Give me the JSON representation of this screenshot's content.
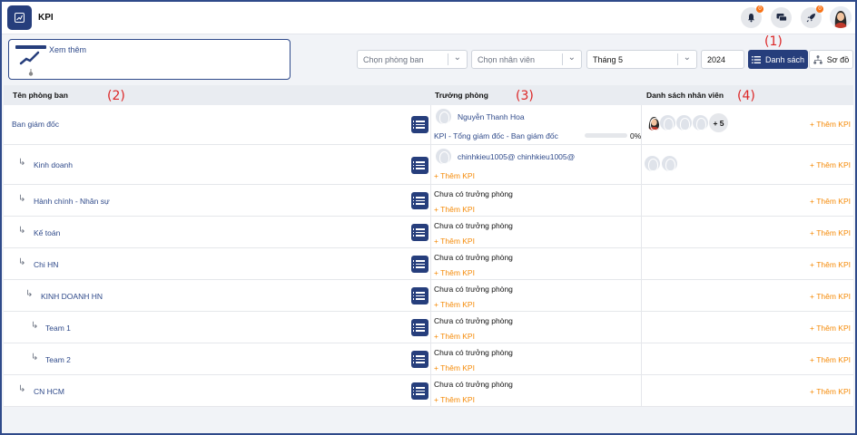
{
  "app": {
    "title": "KPI"
  },
  "header": {
    "notification_badge": "0",
    "rocket_badge": "0"
  },
  "toolbar": {
    "see_more_label": "Xem thêm",
    "department_select": {
      "placeholder": "Chọn phòng ban"
    },
    "employee_select": {
      "placeholder": "Chọn nhân viên"
    },
    "month_select": {
      "value": "Tháng 5"
    },
    "year_field": {
      "value": "2024"
    },
    "list_view_label": "Danh sách",
    "tree_view_label": "Sơ đồ"
  },
  "markers": {
    "m1": "(1)",
    "m2": "(2)",
    "m3": "(3)",
    "m4": "(4)"
  },
  "table": {
    "columns": {
      "department": "Tên phòng ban",
      "head": "Trưởng phòng",
      "staff": "Danh sách nhân viên"
    },
    "no_head_text": "Chưa có trưởng phòng",
    "add_kpi_text": "+ Thêm KPI",
    "rows": [
      {
        "name": "Ban giám đốc",
        "level": 0,
        "head_name": "Nguyễn Thanh Hoa",
        "kpi_title": "KPI - Tổng giám đốc - Ban giám đốc",
        "progress_label": "0%",
        "progress": 0,
        "staff_more": "+ 5"
      },
      {
        "name": "Kinh doanh",
        "level": 1,
        "head_name": "chinhkieu1005@ chinhkieu1005@"
      },
      {
        "name": "Hành chính - Nhân sự",
        "level": 1
      },
      {
        "name": "Kế toán",
        "level": 1
      },
      {
        "name": "Chi HN",
        "level": 1
      },
      {
        "name": "KINH DOANH HN",
        "level": 2
      },
      {
        "name": "Team 1",
        "level": 3
      },
      {
        "name": "Team 2",
        "level": 3
      },
      {
        "name": "CN HCM",
        "level": 1
      }
    ]
  },
  "colors": {
    "primary": "#263e7c",
    "accent_orange": "#f58a07",
    "link_blue": "#2f4a8a",
    "marker_red": "#dc2626"
  }
}
